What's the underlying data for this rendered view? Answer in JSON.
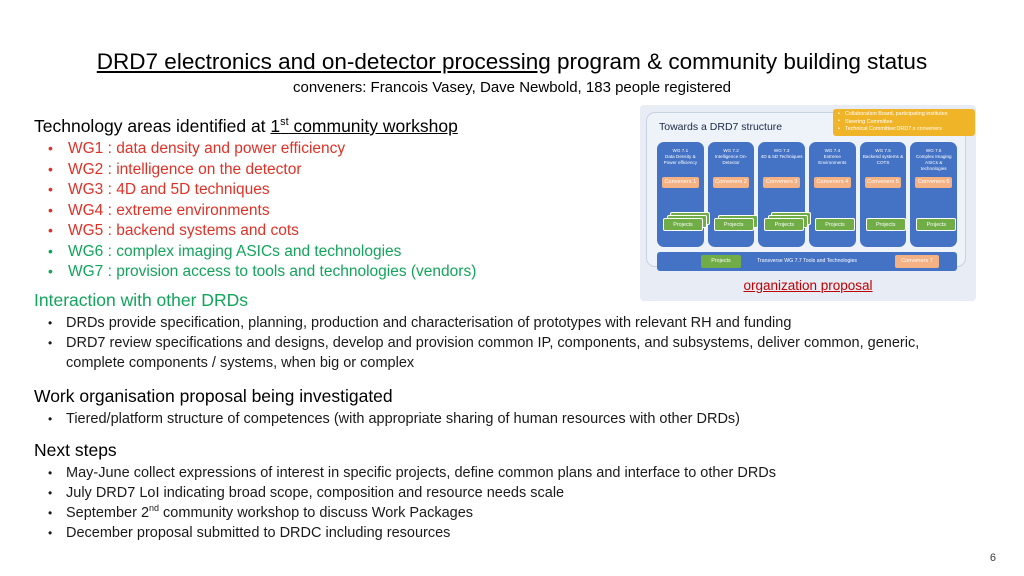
{
  "slide": {
    "title_underlined": "DRD7 electronics and on-detector processing",
    "title_rest": " program & community building status",
    "subtitle": "conveners: Francois Vasey, Dave Newbold, 183 people registered",
    "page_number": "6"
  },
  "sections": {
    "technology": {
      "heading_prefix": "Technology areas identified at ",
      "heading_underlined_pre": "1",
      "heading_underlined_sup": "st",
      "heading_underlined_post": " community workshop",
      "items": [
        {
          "text": "WG1 : data density and power efficiency",
          "color": "#e03127"
        },
        {
          "text": "WG2 : intelligence on the detector",
          "color": "#e03127"
        },
        {
          "text": "WG3 : 4D and 5D techniques",
          "color": "#e03127"
        },
        {
          "text": "WG4 : extreme environments",
          "color": "#e03127"
        },
        {
          "text": "WG5 : backend systems and cots",
          "color": "#e03127"
        },
        {
          "text": "WG6 : complex imaging ASICs and technologies",
          "color": "#12a45b"
        },
        {
          "text": "WG7 : provision access to tools and technologies (vendors)",
          "color": "#12a45b"
        }
      ]
    },
    "interaction": {
      "heading": "Interaction with other DRDs",
      "heading_color": "#12a45b",
      "items": [
        "DRDs provide specification, planning, production and characterisation of prototypes with relevant RH and funding",
        "DRD7 review specifications and designs, develop and provision common IP, components, and subsystems, deliver common, generic, complete components / systems, when big or complex"
      ]
    },
    "work_organisation": {
      "heading": "Work organisation proposal being investigated",
      "items": [
        "Tiered/platform structure of competences (with appropriate sharing of human resources with other DRDs)"
      ]
    },
    "next_steps": {
      "heading": "Next steps",
      "items": [
        {
          "pre": "May-June collect expressions of interest in specific projects, define common plans and interface to other DRDs",
          "sup": "",
          "post": ""
        },
        {
          "pre": "July DRD7 LoI indicating broad scope, composition and resource needs scale",
          "sup": "",
          "post": ""
        },
        {
          "pre": "September 2",
          "sup": "nd",
          "post": " community workshop to discuss Work Packages"
        },
        {
          "pre": "December proposal submitted to DRDC including resources",
          "sup": "",
          "post": ""
        }
      ]
    }
  },
  "org_figure": {
    "title": "Towards a DRD7 structure",
    "caption": "organization proposal",
    "governance": [
      "Collaboration Board, participating institutes",
      "Steering Committee",
      "Technical Committee:DRD7.x conveners"
    ],
    "working_groups": [
      {
        "id": "WG 7.1",
        "name": "Data Density & Power efficiency",
        "conveners": "Conveners 1",
        "projects_label": "Projects",
        "project_stack": 3
      },
      {
        "id": "WG 7.2",
        "name": "Intelligence On-Detector",
        "conveners": "Conveners 2",
        "projects_label": "Projects",
        "project_stack": 2
      },
      {
        "id": "WG 7.3",
        "name": "4D & 5D Techniques",
        "conveners": "Conveners 3",
        "projects_label": "Projects",
        "project_stack": 3
      },
      {
        "id": "WG 7.4",
        "name": "Extreme Environments",
        "conveners": "Conveners 4",
        "projects_label": "Projects",
        "project_stack": 1
      },
      {
        "id": "WG 7.5",
        "name": "Backend systems & COTS",
        "conveners": "Conveners 5",
        "projects_label": "Projects",
        "project_stack": 1
      },
      {
        "id": "WG 7.6",
        "name": "Complex Imaging ASICs & technologies",
        "conveners": "Conveners 6",
        "projects_label": "Projects",
        "project_stack": 1
      }
    ],
    "transverse": {
      "projects_label": "Projects",
      "label": "Transverse WG 7.7 Tools and Technologies",
      "conveners": "Conveners 7"
    },
    "colors": {
      "wg_blue": "#4472c4",
      "conveners_orange": "#f4b183",
      "projects_green": "#70ad47",
      "governance_yellow": "#f0b429",
      "card_background": "#eef2f9",
      "caption_red": "#c00000"
    }
  }
}
